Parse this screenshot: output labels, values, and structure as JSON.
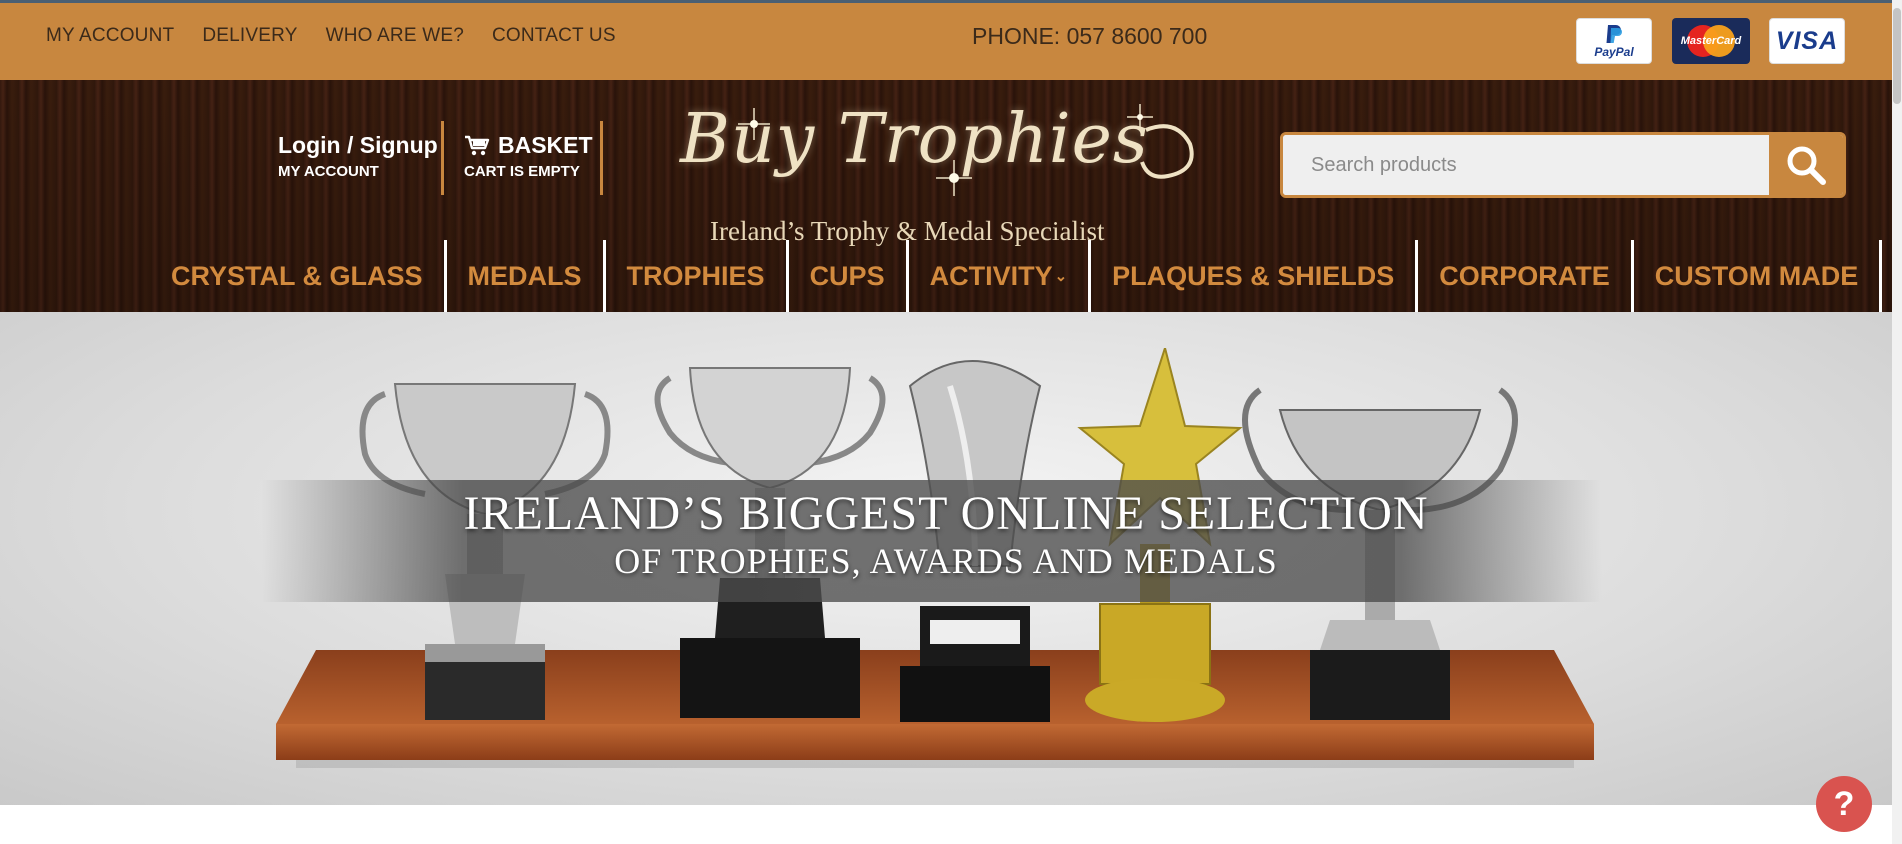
{
  "topbar": {
    "links": [
      "MY ACCOUNT",
      "DELIVERY",
      "WHO ARE WE?",
      "CONTACT US"
    ],
    "phone": "PHONE: 057 8600 700",
    "payments": {
      "paypal": "PayPal",
      "mastercard": "MasterCard",
      "visa": "VISA"
    }
  },
  "header": {
    "login": "Login / Signup",
    "my_account": "MY ACCOUNT",
    "basket": "BASKET",
    "cart_status": "CART IS EMPTY",
    "logo_text": "Buy Trophies",
    "logo_tagline": "Ireland’s Trophy & Medal Specialist",
    "search_placeholder": "Search products"
  },
  "nav": {
    "items": [
      "CRYSTAL & GLASS",
      "MEDALS",
      "TROPHIES",
      "CUPS",
      "ACTIVITY",
      "PLAQUES & SHIELDS",
      "CORPORATE",
      "CUSTOM MADE"
    ]
  },
  "hero": {
    "line1": "IRELAND’S BIGGEST ONLINE SELECTION",
    "line2": "OF TROPHIES, AWARDS AND MEDALS"
  },
  "help": {
    "label": "?"
  },
  "colors": {
    "accent": "#c8873f",
    "nav_text": "#d28a3e",
    "dark_wood": "#3a1c10"
  }
}
